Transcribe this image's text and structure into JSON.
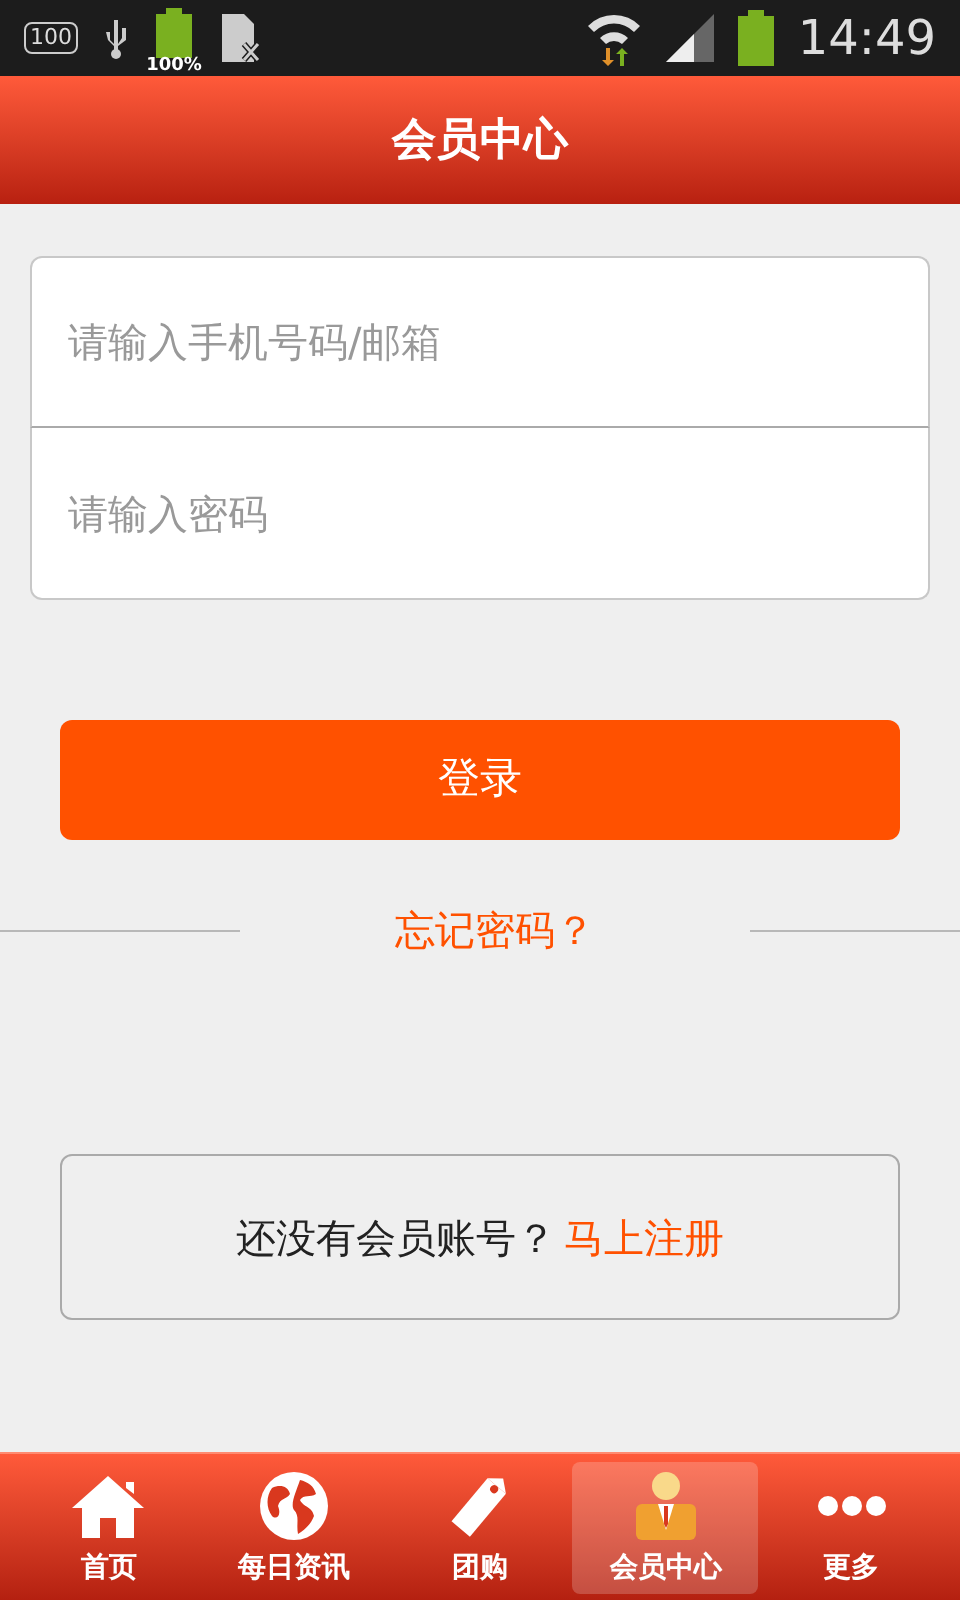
{
  "status_bar": {
    "box_label": "100",
    "battery_label": "100%",
    "time": "14:49"
  },
  "header": {
    "title": "会员中心"
  },
  "form": {
    "account_placeholder": "请输入手机号码/邮箱",
    "password_placeholder": "请输入密码",
    "login_button": "登录",
    "forgot_link": "忘记密码？"
  },
  "register": {
    "prompt": "还没有会员账号？",
    "link": "马上注册"
  },
  "tab_bar": [
    {
      "kind": "home",
      "label": "首页",
      "selected": false
    },
    {
      "kind": "globe",
      "label": "每日资讯",
      "selected": false
    },
    {
      "kind": "tag",
      "label": "团购",
      "selected": false
    },
    {
      "kind": "member",
      "label": "会员中心",
      "selected": true
    },
    {
      "kind": "more",
      "label": "更多",
      "selected": false
    }
  ]
}
